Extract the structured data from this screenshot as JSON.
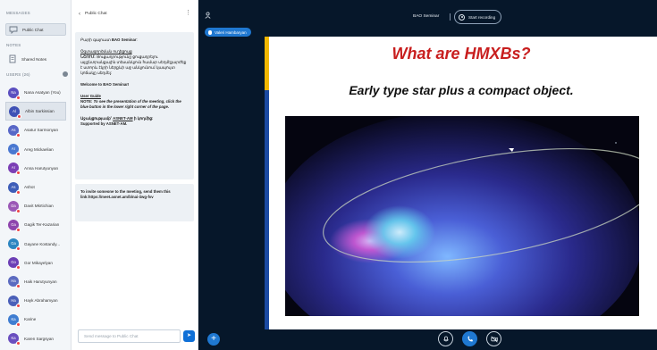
{
  "sidebar": {
    "messages_label": "MESSAGES",
    "public_chat_label": "Public Chat",
    "notes_label": "NOTES",
    "shared_notes_label": "Shared Notes",
    "users_label": "USERS (26)",
    "users": [
      {
        "initials": "Na",
        "name": "Nana Asatyan (You)",
        "color": "#5b4fbf"
      },
      {
        "initials": "Al",
        "name": "Albin Sarkissian",
        "color": "#3f51b5",
        "selected": true
      },
      {
        "initials": "As",
        "name": "Asatur Sarmonyan",
        "color": "#5867c7"
      },
      {
        "initials": "Ar",
        "name": "Areg Mickaelian",
        "color": "#4a78d1"
      },
      {
        "initials": "Ar",
        "name": "Anna Harutyunyan",
        "color": "#7b3fb5"
      },
      {
        "initials": "As",
        "name": "Ashot",
        "color": "#3d5db8"
      },
      {
        "initials": "Da",
        "name": "Davit Mkrtichian",
        "color": "#9b59b6"
      },
      {
        "initials": "Ga",
        "name": "Gagik Ter-Kazarian",
        "color": "#8e44ad"
      },
      {
        "initials": "Ga",
        "name": "Gayane Kostandy...",
        "color": "#2e86c1"
      },
      {
        "initials": "Go",
        "name": "Gor Mikayelyan",
        "color": "#6c3fb5"
      },
      {
        "initials": "Ha",
        "name": "Haik Harutyunyan",
        "color": "#5c6bc0"
      },
      {
        "initials": "Ha",
        "name": "Hayk Abrahamyan",
        "color": "#4a5fb8"
      },
      {
        "initials": "Ka",
        "name": "Karine",
        "color": "#3f7dd1"
      },
      {
        "initials": "Ka",
        "name": "Karen Sargsyan",
        "color": "#6a4fbf"
      }
    ]
  },
  "chat": {
    "title": "Public Chat",
    "welcome": {
      "greeting_prefix": "Բարի գալուստ ",
      "greeting_name": "BAO Seminar",
      "greeting_suffix": ":",
      "guide_am_title": "Օգտագործման ուղեցույց",
      "guide_am_note_label": "ՆՇՈՒՄ:",
      "guide_am_note": " Ցուցադրությունը ցուցադրելու այլընտրանքային տեսանկյուն համար սեղմէքարժեք է ստորև էկրի ներքևի աջ անկյունում կապույտ կոճակը սեղմել:",
      "welcome_en": "Welcome to BAO Seminar!",
      "guide_en_title": "User Guide",
      "guide_en_note_label": "NOTE:",
      "guide_en_note": " To see the presentation of the meeting, click the blue button in the lower right corner of the page.",
      "support_am_prefix": "Աջակցությամբ՝ ",
      "support_am_link": "ASNET-AM",
      "support_am_suffix": " ի կողմից:",
      "support_en": "Supported by ASNET-AM."
    },
    "invite_text": "To invite someone to the meeting, send them this link:https://meet.asnet.am/b/nai-iiwg-fvv",
    "input_placeholder": "Send message to Public Chat"
  },
  "presentation": {
    "meeting_name": "BAO Seminar",
    "record_label": "Start recording",
    "presenter_name": "Valeri Hambaryan",
    "slide_title": "What are HMXBs?",
    "slide_subtitle": "Early type star plus a compact object."
  }
}
